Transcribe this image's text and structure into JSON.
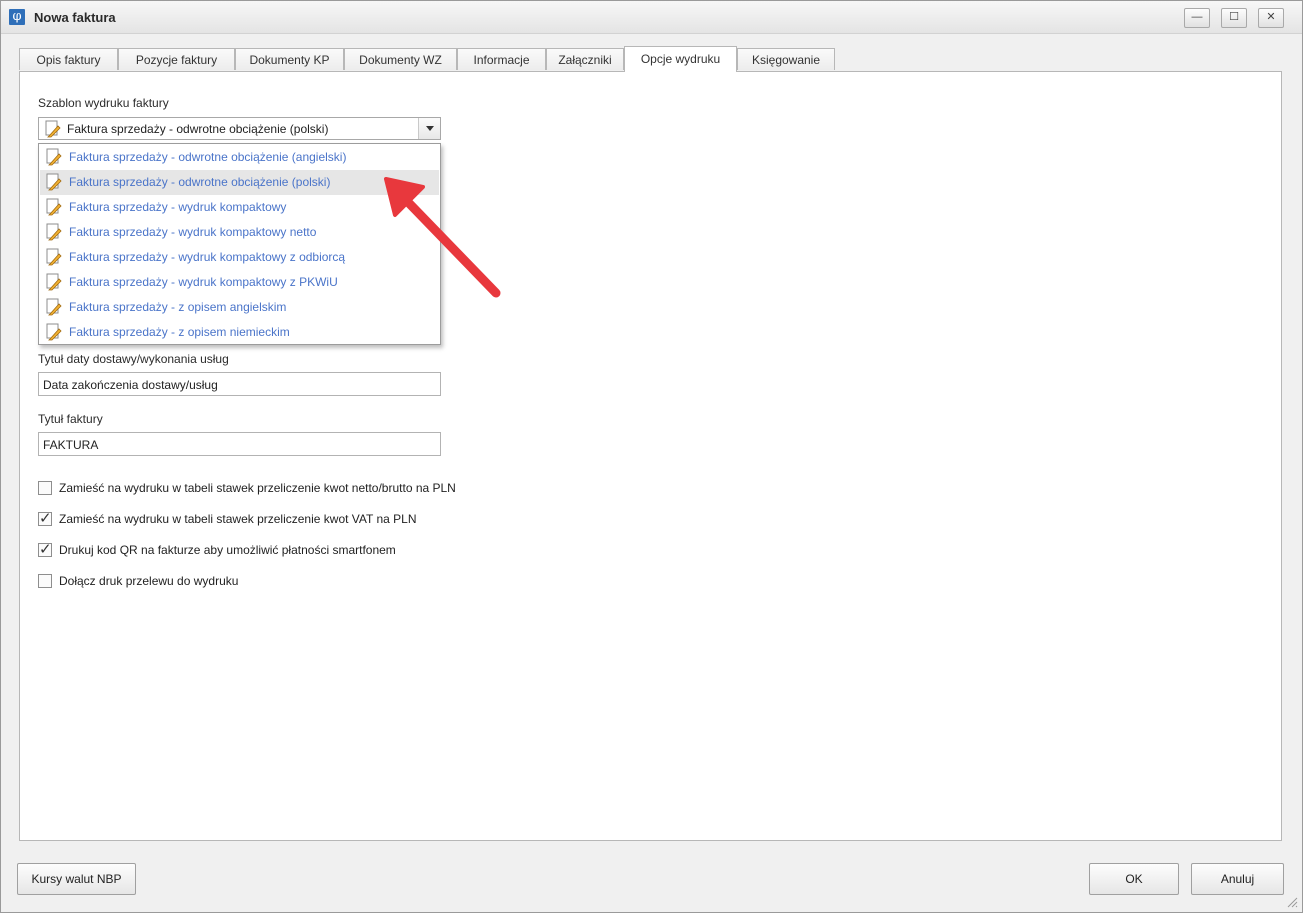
{
  "window": {
    "title": "Nowa faktura",
    "app_icon_glyph": "φ",
    "minimize_glyph": "—",
    "maximize_glyph": "☐",
    "close_glyph": "✕"
  },
  "tabs": [
    {
      "label": "Opis faktury"
    },
    {
      "label": "Pozycje faktury"
    },
    {
      "label": "Dokumenty KP"
    },
    {
      "label": "Dokumenty WZ"
    },
    {
      "label": "Informacje"
    },
    {
      "label": "Załączniki"
    },
    {
      "label": "Opcje wydruku"
    },
    {
      "label": "Księgowanie"
    }
  ],
  "active_tab": "Opcje wydruku",
  "template": {
    "label": "Szablon wydruku faktury",
    "selected": "Faktura sprzedaży - odwrotne obciążenie (polski)",
    "options": [
      "Faktura sprzedaży - odwrotne obciążenie (angielski)",
      "Faktura sprzedaży - odwrotne obciążenie (polski)",
      "Faktura sprzedaży - wydruk kompaktowy",
      "Faktura sprzedaży - wydruk kompaktowy netto",
      "Faktura sprzedaży - wydruk kompaktowy z odbiorcą",
      "Faktura sprzedaży - wydruk kompaktowy z PKWiU",
      "Faktura sprzedaży - z opisem angielskim",
      "Faktura sprzedaży - z opisem niemieckim"
    ]
  },
  "delivery_date_title": {
    "label": "Tytuł daty dostawy/wykonania usług",
    "value": "Data zakończenia dostawy/usług"
  },
  "invoice_title": {
    "label": "Tytuł faktury",
    "value": "FAKTURA"
  },
  "checkboxes": [
    {
      "label": "Zamieść na wydruku w tabeli stawek przeliczenie kwot netto/brutto na PLN",
      "checked": false
    },
    {
      "label": "Zamieść na wydruku w tabeli stawek przeliczenie kwot VAT na PLN",
      "checked": true
    },
    {
      "label": "Drukuj kod QR na fakturze aby umożliwić płatności smartfonem",
      "checked": true
    },
    {
      "label": "Dołącz druk przelewu do wydruku",
      "checked": false
    }
  ],
  "check_glyph": "✓",
  "footer": {
    "exchange_rates_label": "Kursy walut NBP",
    "ok_label": "OK",
    "cancel_label": "Anuluj"
  },
  "colors": {
    "dropdown_text": "#4a74c9",
    "annotation_arrow": "#e8383d",
    "selected_row_bg": "#e6e6e6"
  }
}
